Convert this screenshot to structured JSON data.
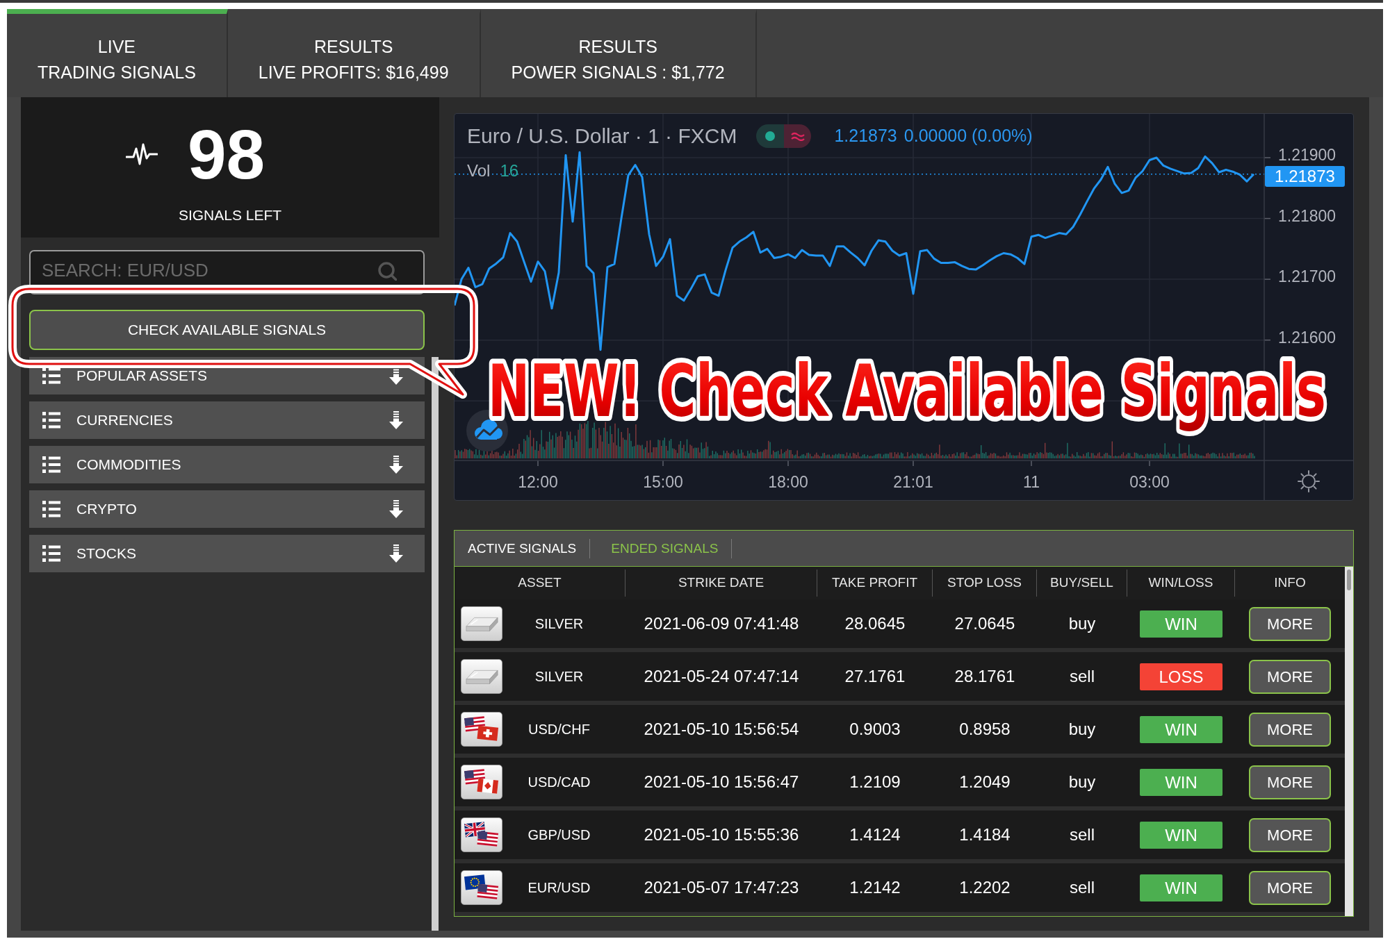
{
  "top_tabs": [
    {
      "lines": [
        "LIVE",
        "TRADING SIGNALS"
      ],
      "selected": true
    },
    {
      "lines": [
        "RESULTS",
        "LIVE PROFITS: $16,499"
      ],
      "selected": false
    },
    {
      "lines": [
        "RESULTS",
        "POWER SIGNALS : $1,772"
      ],
      "selected": false
    }
  ],
  "signals_counter": {
    "count": "98",
    "label": "SIGNALS LEFT"
  },
  "search": {
    "placeholder": "SEARCH: EUR/USD"
  },
  "check_button": {
    "label": "CHECK AVAILABLE SIGNALS"
  },
  "asset_groups": [
    {
      "label": "POPULAR ASSETS"
    },
    {
      "label": "CURRENCIES"
    },
    {
      "label": "COMMODITIES"
    },
    {
      "label": "CRYPTO"
    },
    {
      "label": "STOCKS"
    }
  ],
  "chart": {
    "title": "Euro / U.S. Dollar · 1 · FXCM",
    "price": "1.21873",
    "change": "0.00000 (0.00%)",
    "volume_label": "Vol",
    "volume_value": "16",
    "price_tag": "1.21873",
    "chart_data": {
      "type": "line",
      "grid": true,
      "categories": [
        null,
        null,
        null,
        null,
        null,
        null,
        null,
        null,
        null,
        null,
        null,
        null,
        "12:00",
        null,
        null,
        null,
        null,
        null,
        null,
        null,
        null,
        null,
        null,
        null,
        null,
        null,
        null,
        null,
        null,
        null,
        "15:00",
        null,
        null,
        null,
        null,
        null,
        null,
        null,
        null,
        null,
        null,
        null,
        null,
        null,
        null,
        null,
        null,
        null,
        "18:00",
        null,
        null,
        null,
        null,
        null,
        null,
        null,
        null,
        null,
        null,
        null,
        null,
        null,
        null,
        null,
        null,
        null,
        "21:01",
        null,
        null,
        null,
        null,
        null,
        null,
        null,
        null,
        null,
        null,
        null,
        null,
        null,
        null,
        null,
        null,
        "11",
        null,
        null,
        null,
        null,
        null,
        null,
        null,
        null,
        null,
        null,
        null,
        null,
        null,
        null,
        null,
        null,
        "03:00",
        null,
        null,
        null,
        null,
        null,
        null,
        null,
        null,
        null,
        null,
        null,
        null,
        null,
        null,
        null
      ],
      "series": [
        {
          "color": "#2196f3",
          "values": [
            1.21657,
            1.217,
            1.21719,
            1.21687,
            1.21692,
            1.21718,
            1.21726,
            1.21736,
            1.21776,
            1.21762,
            1.21729,
            1.21696,
            1.21729,
            1.21713,
            1.21652,
            1.21711,
            1.21904,
            1.21795,
            1.21909,
            1.21722,
            1.2171,
            1.21584,
            1.2172,
            1.21725,
            1.218,
            1.21871,
            1.21888,
            1.21868,
            1.21774,
            1.21722,
            1.21737,
            1.21766,
            1.21673,
            1.21665,
            1.21684,
            1.21705,
            1.21708,
            1.21678,
            1.21673,
            1.21715,
            1.21752,
            1.21762,
            1.21769,
            1.21778,
            1.21744,
            1.2175,
            1.21735,
            1.21737,
            1.21741,
            1.21735,
            1.21748,
            1.2174,
            1.21739,
            1.21739,
            1.21722,
            1.21754,
            1.21754,
            1.21744,
            1.21735,
            1.21723,
            1.21747,
            1.21764,
            1.21762,
            1.21747,
            1.21739,
            1.21743,
            1.21676,
            1.21746,
            1.21748,
            1.21734,
            1.21727,
            1.21727,
            1.21728,
            1.21722,
            1.21717,
            1.21716,
            1.21723,
            1.21731,
            1.21738,
            1.21743,
            1.21741,
            1.21735,
            1.21725,
            1.2177,
            1.21773,
            1.21768,
            1.21772,
            1.21776,
            1.21774,
            1.21786,
            1.21806,
            1.21828,
            1.21849,
            1.21864,
            1.21885,
            1.21857,
            1.21842,
            1.21846,
            1.21867,
            1.21878,
            1.21896,
            1.219,
            1.21887,
            1.21882,
            1.21878,
            1.21874,
            1.21875,
            1.21883,
            1.21902,
            1.21891,
            1.21876,
            1.2188,
            1.21877,
            1.21872,
            1.21861,
            1.21873
          ]
        }
      ],
      "ylim": [
        1.21402,
        1.21972
      ],
      "yticks": [
        {
          "value": 1.219,
          "label": "1.21900"
        },
        {
          "value": 1.218,
          "label": "1.21800"
        },
        {
          "value": 1.217,
          "label": "1.21700"
        },
        {
          "value": 1.216,
          "label": "1.21600"
        }
      ],
      "ref_lines": [
        {
          "axis": "y",
          "value": 1.21873,
          "color": "#2196f3"
        }
      ]
    }
  },
  "signals_table": {
    "tabs": [
      {
        "label": "ACTIVE SIGNALS",
        "selected": false
      },
      {
        "label": "ENDED SIGNALS",
        "selected": true
      }
    ],
    "columns": [
      "ASSET",
      "STRIKE DATE",
      "TAKE PROFIT",
      "STOP LOSS",
      "BUY/SELL",
      "WIN/LOSS",
      "INFO"
    ],
    "rows": [
      {
        "kind": "silver",
        "asset": "SILVER",
        "strike_date": "2021-06-09 07:41:48",
        "take_profit": "28.0645",
        "stop_loss": "27.0645",
        "direction": "buy",
        "result": {
          "label": "WIN",
          "kind": "win"
        },
        "action": "MORE"
      },
      {
        "kind": "silver",
        "asset": "SILVER",
        "strike_date": "2021-05-24 07:47:14",
        "take_profit": "27.1761",
        "stop_loss": "28.1761",
        "direction": "sell",
        "result": {
          "label": "LOSS",
          "kind": "loss"
        },
        "action": "MORE"
      },
      {
        "kind": "usdchf",
        "asset": "USD/CHF",
        "strike_date": "2021-05-10 15:56:54",
        "take_profit": "0.9003",
        "stop_loss": "0.8958",
        "direction": "buy",
        "result": {
          "label": "WIN",
          "kind": "win"
        },
        "action": "MORE"
      },
      {
        "kind": "usdcad",
        "asset": "USD/CAD",
        "strike_date": "2021-05-10 15:56:47",
        "take_profit": "1.2109",
        "stop_loss": "1.2049",
        "direction": "buy",
        "result": {
          "label": "WIN",
          "kind": "win"
        },
        "action": "MORE"
      },
      {
        "kind": "gbpusd",
        "asset": "GBP/USD",
        "strike_date": "2021-05-10 15:55:36",
        "take_profit": "1.4124",
        "stop_loss": "1.4184",
        "direction": "sell",
        "result": {
          "label": "WIN",
          "kind": "win"
        },
        "action": "MORE"
      },
      {
        "kind": "eurusd",
        "asset": "EUR/USD",
        "strike_date": "2021-05-07 17:47:23",
        "take_profit": "1.2142",
        "stop_loss": "1.2202",
        "direction": "sell",
        "result": {
          "label": "WIN",
          "kind": "win"
        },
        "action": "MORE"
      }
    ]
  },
  "callout": {
    "text": "NEW! Check Available Signals"
  }
}
